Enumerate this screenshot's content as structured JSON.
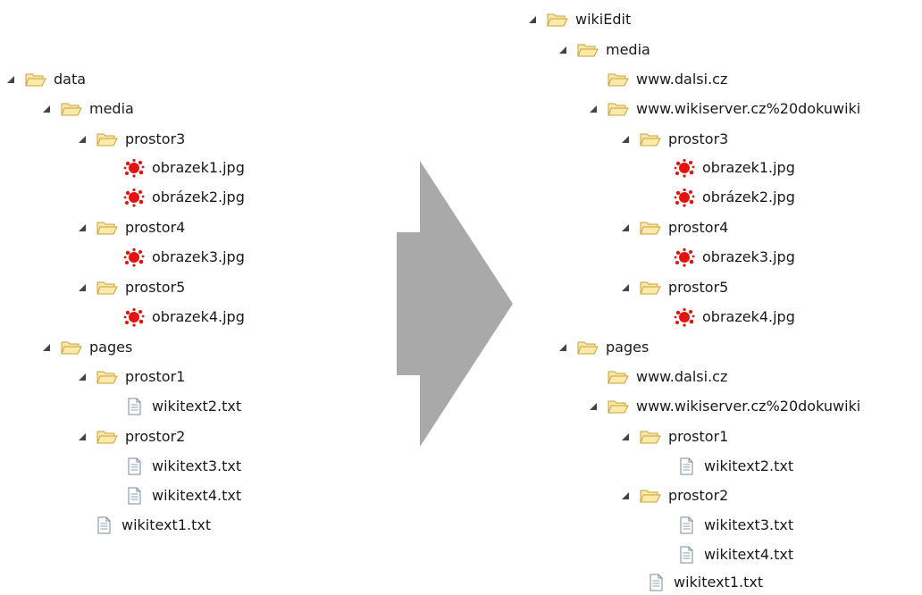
{
  "left_tree": {
    "nodes": [
      {
        "label": "data",
        "type": "folder",
        "expanded": true
      },
      {
        "label": "media",
        "type": "folder",
        "expanded": true
      },
      {
        "label": "prostor3",
        "type": "folder",
        "expanded": true
      },
      {
        "label": "obrazek1.jpg",
        "type": "image"
      },
      {
        "label": "obrázek2.jpg",
        "type": "image"
      },
      {
        "label": "prostor4",
        "type": "folder",
        "expanded": true
      },
      {
        "label": "obrazek3.jpg",
        "type": "image"
      },
      {
        "label": "prostor5",
        "type": "folder",
        "expanded": true
      },
      {
        "label": "obrazek4.jpg",
        "type": "image"
      },
      {
        "label": "pages",
        "type": "folder",
        "expanded": true
      },
      {
        "label": "prostor1",
        "type": "folder",
        "expanded": true
      },
      {
        "label": "wikitext2.txt",
        "type": "text"
      },
      {
        "label": "prostor2",
        "type": "folder",
        "expanded": true
      },
      {
        "label": "wikitext3.txt",
        "type": "text"
      },
      {
        "label": "wikitext4.txt",
        "type": "text"
      },
      {
        "label": "wikitext1.txt",
        "type": "text"
      }
    ]
  },
  "right_tree": {
    "nodes": [
      {
        "label": "wikiEdit",
        "type": "folder",
        "expanded": true
      },
      {
        "label": "media",
        "type": "folder",
        "expanded": true
      },
      {
        "label": "www.dalsi.cz",
        "type": "folder",
        "expanded": false
      },
      {
        "label": "www.wikiserver.cz%20dokuwiki",
        "type": "folder",
        "expanded": true
      },
      {
        "label": "prostor3",
        "type": "folder",
        "expanded": true
      },
      {
        "label": "obrazek1.jpg",
        "type": "image"
      },
      {
        "label": "obrázek2.jpg",
        "type": "image"
      },
      {
        "label": "prostor4",
        "type": "folder",
        "expanded": true
      },
      {
        "label": "obrazek3.jpg",
        "type": "image"
      },
      {
        "label": "prostor5",
        "type": "folder",
        "expanded": true
      },
      {
        "label": "obrazek4.jpg",
        "type": "image"
      },
      {
        "label": "pages",
        "type": "folder",
        "expanded": true
      },
      {
        "label": "www.dalsi.cz",
        "type": "folder",
        "expanded": false
      },
      {
        "label": "www.wikiserver.cz%20dokuwiki",
        "type": "folder",
        "expanded": true
      },
      {
        "label": "prostor1",
        "type": "folder",
        "expanded": true
      },
      {
        "label": "wikitext2.txt",
        "type": "text"
      },
      {
        "label": "prostor2",
        "type": "folder",
        "expanded": true
      },
      {
        "label": "wikitext3.txt",
        "type": "text"
      },
      {
        "label": "wikitext4.txt",
        "type": "text"
      },
      {
        "label": "wikitext1.txt",
        "type": "text"
      }
    ]
  },
  "icons": {
    "folder": "folder-open-icon",
    "image": "image-file-icon",
    "text": "text-file-icon",
    "expander": "expand-triangle-icon",
    "arrow": "right-arrow-icon"
  },
  "colors": {
    "folder_fill": "#fbe7a6",
    "folder_stroke": "#c9a23b",
    "image_red": "#e3140f",
    "arrow_gray": "#a9a9a9"
  }
}
